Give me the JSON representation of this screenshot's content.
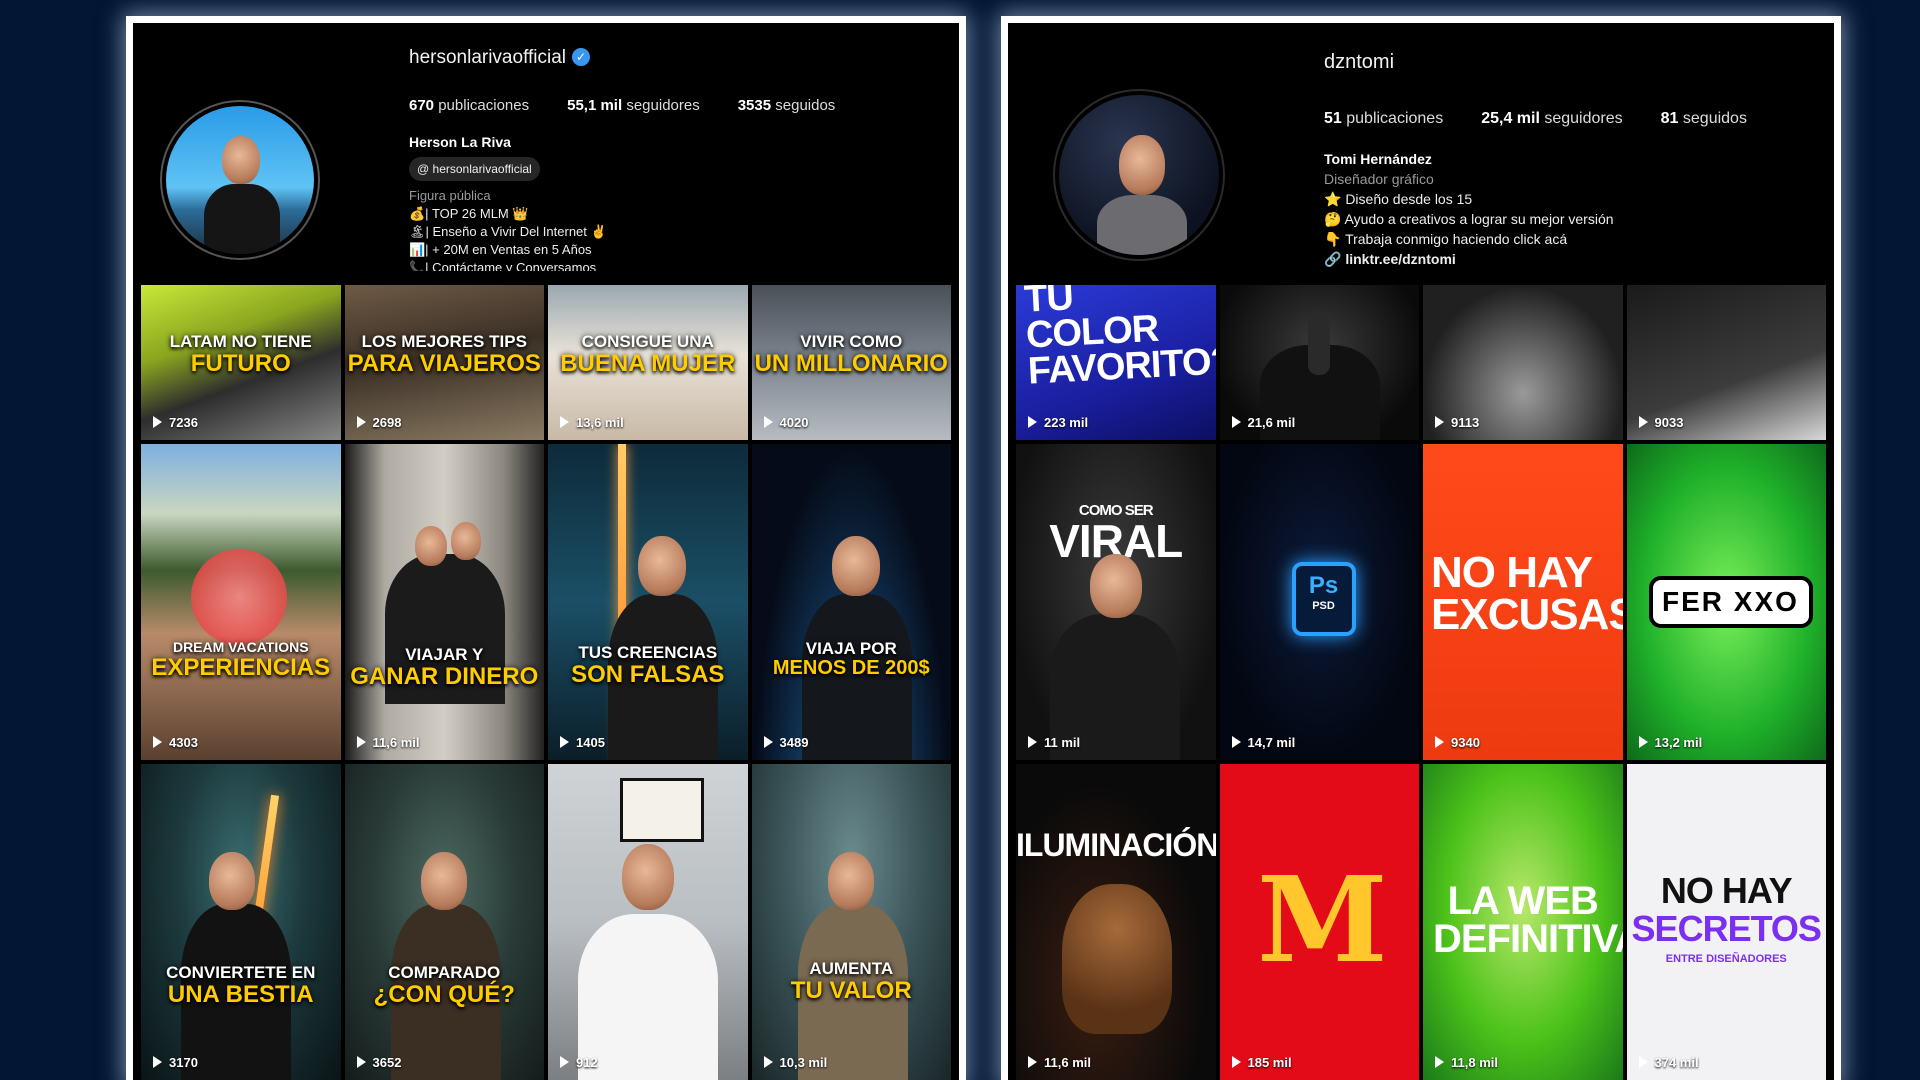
{
  "left": {
    "username": "hersonlarivaofficial",
    "verified_icon": "verified-badge-icon",
    "stats": {
      "posts_count": "670",
      "posts_label": "publicaciones",
      "followers_count": "55,1 mil",
      "followers_label": "seguidores",
      "following_count": "3535",
      "following_label": "seguidos"
    },
    "full_name": "Herson La Riva",
    "threads_handle": "hersonlarivaofficial",
    "category": "Figura pública",
    "bio_lines": [
      "💰| TOP 26 MLM 👑",
      "🏝| Enseño a Vivir Del Internet ✌",
      "📊| + 20M en Ventas en 5 Años",
      "📞| Contáctame y Conversamos"
    ],
    "posts": [
      {
        "line1": "LATAM NO TIENE",
        "line2": "FUTURO",
        "views": "7236"
      },
      {
        "line1": "LOS MEJORES TIPS",
        "line2": "PARA VIAJEROS",
        "views": "2698"
      },
      {
        "line1": "CONSIGUE UNA",
        "line2": "BUENA MUJER",
        "views": "13,6 mil"
      },
      {
        "line1": "VIVIR COMO",
        "line2": "UN MILLONARIO",
        "views": "4020"
      },
      {
        "line1": "DREAM VACATIONS",
        "line2": "EXPERIENCIAS",
        "views": "4303"
      },
      {
        "line1": "VIAJAR Y",
        "line2": "GANAR DINERO",
        "views": "11,6 mil"
      },
      {
        "line1": "TUS CREENCIAS",
        "line2": "SON FALSAS",
        "views": "1405"
      },
      {
        "line1": "VIAJA POR",
        "line2": "MENOS DE 200$",
        "views": "3489"
      },
      {
        "line1": "CONVIERTETE EN",
        "line2": "UNA BESTIA",
        "views": "3170"
      },
      {
        "line1": "COMPARADO",
        "line2": "¿CON QUÉ?",
        "views": "3652"
      },
      {
        "line1": "",
        "line2": "",
        "views": "912"
      },
      {
        "line1": "AUMENTA",
        "line2": "TU VALOR",
        "views": "10,3 mil"
      }
    ]
  },
  "right": {
    "username": "dzntomi",
    "stats": {
      "posts_count": "51",
      "posts_label": "publicaciones",
      "followers_count": "25,4 mil",
      "followers_label": "seguidores",
      "following_count": "81",
      "following_label": "seguidos"
    },
    "full_name": "Tomi Hernández",
    "category": "Diseñador gráfico",
    "bio_lines": [
      "⭐ Diseño desde los 15",
      "🤔 Ayudo a creativos a lograr su mejor versión",
      "👇 Trabaja conmigo haciendo click acá"
    ],
    "link": "linktr.ee/dzntomi",
    "posts": [
      {
        "text": "TU COLOR FAVORITO?",
        "views": "223 mil"
      },
      {
        "text": "",
        "views": "21,6 mil"
      },
      {
        "text": "",
        "views": "9113"
      },
      {
        "text": "",
        "views": "9033"
      },
      {
        "text_small": "COMO SER",
        "text": "VIRAL",
        "views": "11 mil"
      },
      {
        "text": "PSD",
        "views": "14,7 mil"
      },
      {
        "text": "NO HAY EXCUSAS.",
        "views": "9340"
      },
      {
        "text": "FER XXO",
        "views": "13,2 mil"
      },
      {
        "text": "ILUMINACIÓN",
        "views": "11,6 mil"
      },
      {
        "text": "M",
        "views": "185 mil"
      },
      {
        "text": "LA WEB DEFINITIVA",
        "views": "11,8 mil"
      },
      {
        "text": "NO HAY",
        "text2": "SECRETOS",
        "text3": "ENTRE DISEÑADORES",
        "views": "374 mil"
      }
    ]
  },
  "colors": {
    "background": "#031633",
    "panel_glow": "#ffffff",
    "caption_yellow": "#ffcc00",
    "verified_blue": "#3897f0"
  }
}
